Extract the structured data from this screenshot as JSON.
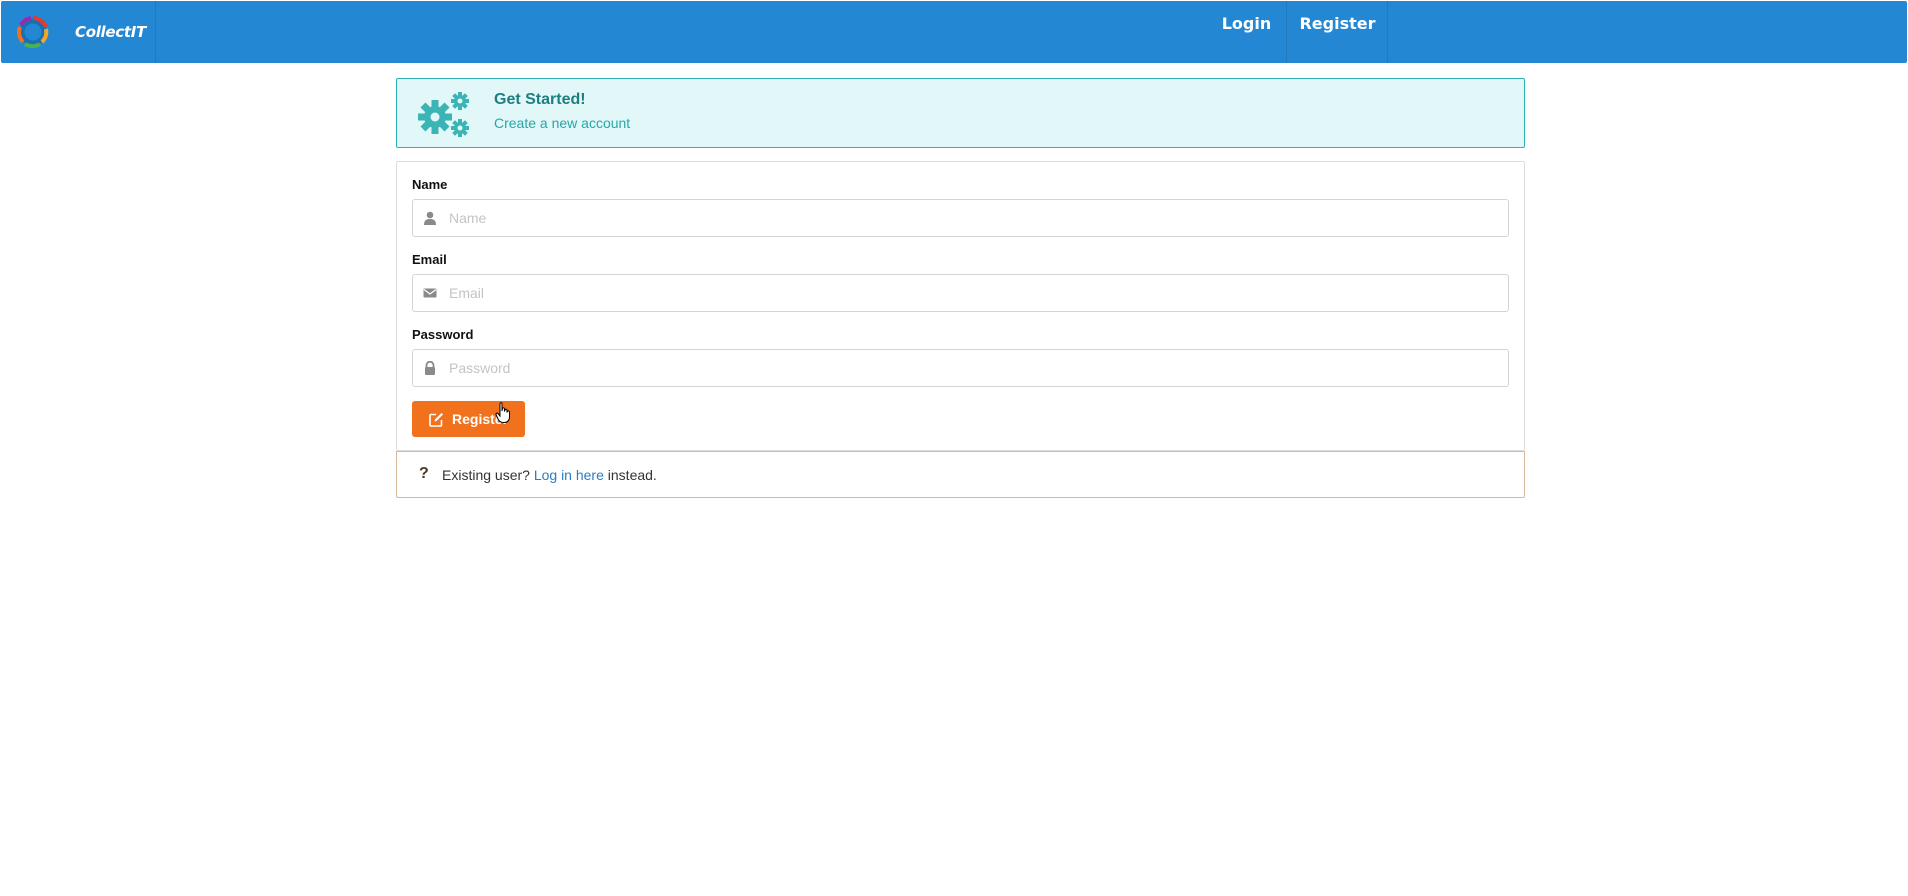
{
  "navbar": {
    "brand": "CollectIT",
    "logo_icon": "collectit-logo-icon",
    "items": [
      {
        "label": "Login"
      },
      {
        "label": "Register"
      }
    ],
    "background": "#2387d3"
  },
  "banner": {
    "icon": "cogs-icon",
    "title": "Get Started!",
    "subtitle": "Create a new account",
    "color": "#2bb2b3"
  },
  "form": {
    "fields": [
      {
        "label": "Name",
        "placeholder": "Name",
        "value": "",
        "icon": "user-icon"
      },
      {
        "label": "Email",
        "placeholder": "Email",
        "value": "",
        "icon": "envelope-icon"
      },
      {
        "label": "Password",
        "placeholder": "Password",
        "value": "",
        "icon": "lock-icon"
      }
    ],
    "submit": {
      "label": "Register",
      "icon": "edit-icon",
      "color": "#f2711c"
    }
  },
  "note": {
    "icon": "question-icon",
    "prefix": "Existing user?",
    "link": "Log in here",
    "suffix": "instead."
  }
}
